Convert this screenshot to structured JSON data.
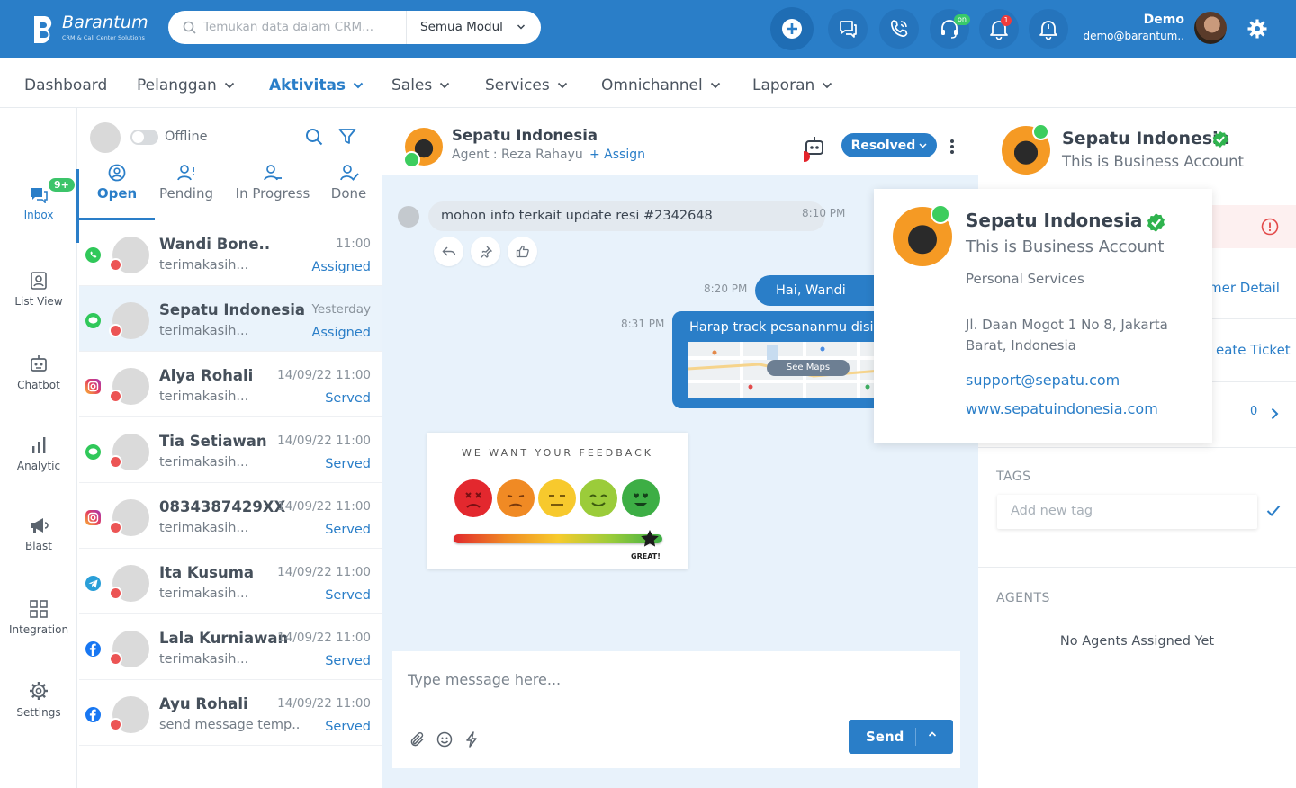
{
  "brand": {
    "name": "Barantum",
    "tagline": "CRM & Call Center Solutions"
  },
  "search": {
    "placeholder": "Temukan data dalam CRM...",
    "module": "Semua Modul"
  },
  "topbar": {
    "notif_count": "1",
    "online_badge": "on"
  },
  "user": {
    "name": "Demo",
    "email": "demo@barantum.."
  },
  "nav": [
    "Dashboard",
    "Pelanggan",
    "Aktivitas",
    "Sales",
    "Services",
    "Omnichannel",
    "Laporan"
  ],
  "leftnav": {
    "inbox_badge": "9+",
    "items": [
      "Inbox",
      "List View",
      "Chatbot",
      "Analytic",
      "Blast",
      "Integration",
      "Settings"
    ]
  },
  "convlist": {
    "status": "Offline",
    "tabs": [
      "Open",
      "Pending",
      "In Progress",
      "Done"
    ],
    "items": [
      {
        "name": "Wandi Bone..",
        "msg": "terimakasih...",
        "time": "11:00",
        "status": "Assigned",
        "channel": "whatsapp"
      },
      {
        "name": "Sepatu Indonesia",
        "msg": "terimakasih...",
        "time": "Yesterday",
        "status": "Assigned",
        "channel": "line"
      },
      {
        "name": "Alya Rohali",
        "msg": "terimakasih...",
        "time": "14/09/22 11:00",
        "status": "Served",
        "channel": "instagram"
      },
      {
        "name": "Tia Setiawan",
        "msg": "terimakasih...",
        "time": "14/09/22 11:00",
        "status": "Served",
        "channel": "line"
      },
      {
        "name": "0834387429XX",
        "msg": "terimakasih...",
        "time": "14/09/22 11:00",
        "status": "Served",
        "channel": "instagram"
      },
      {
        "name": "Ita Kusuma",
        "msg": "terimakasih...",
        "time": "14/09/22 11:00",
        "status": "Served",
        "channel": "telegram"
      },
      {
        "name": "Lala Kurniawan",
        "msg": "terimakasih...",
        "time": "14/09/22 11:00",
        "status": "Served",
        "channel": "facebook"
      },
      {
        "name": "Ayu Rohali",
        "msg": "send message temp..",
        "time": "14/09/22 11:00",
        "status": "Served",
        "channel": "facebook"
      }
    ]
  },
  "chat": {
    "title": "Sepatu Indonesia",
    "agent": "Agent : Reza Rahayu",
    "assign": "+ Assign",
    "status_button": "Resolved",
    "messages": {
      "in_text": "mohon info terkait update resi #2342648",
      "in_time": "8:10 PM",
      "out1_text": "Hai, Wandi",
      "out1_time": "8:20 PM",
      "out2_text": "Harap track pesananmu disin",
      "out2_time": "8:31 PM",
      "see_maps": "See Maps"
    },
    "feedback": {
      "title": "WE WANT YOUR FEEDBACK",
      "label": "GREAT!",
      "level_percent": 94
    },
    "composer_placeholder": "Type message here...",
    "send": "Send"
  },
  "right": {
    "name": "Sepatu Indonesia",
    "account": "This is Business Account",
    "link1": "mer Detail",
    "link2": "eate Ticket",
    "count": "0",
    "tags_label": "TAGS",
    "tag_placeholder": "Add new tag",
    "agents_label": "AGENTS",
    "no_agents": "No Agents Assigned Yet"
  },
  "popup": {
    "name": "Sepatu Indonesia",
    "account": "This is Business Account",
    "category": "Personal Services",
    "address": "Jl. Daan Mogot 1 No 8, Jakarta Barat, Indonesia",
    "email": "support@sepatu.com",
    "website": "www.sepatuindonesia.com"
  },
  "colors": {
    "primary": "#2a7ec8",
    "offline_dot": "#ec5454",
    "online": "#3ccd5e"
  }
}
